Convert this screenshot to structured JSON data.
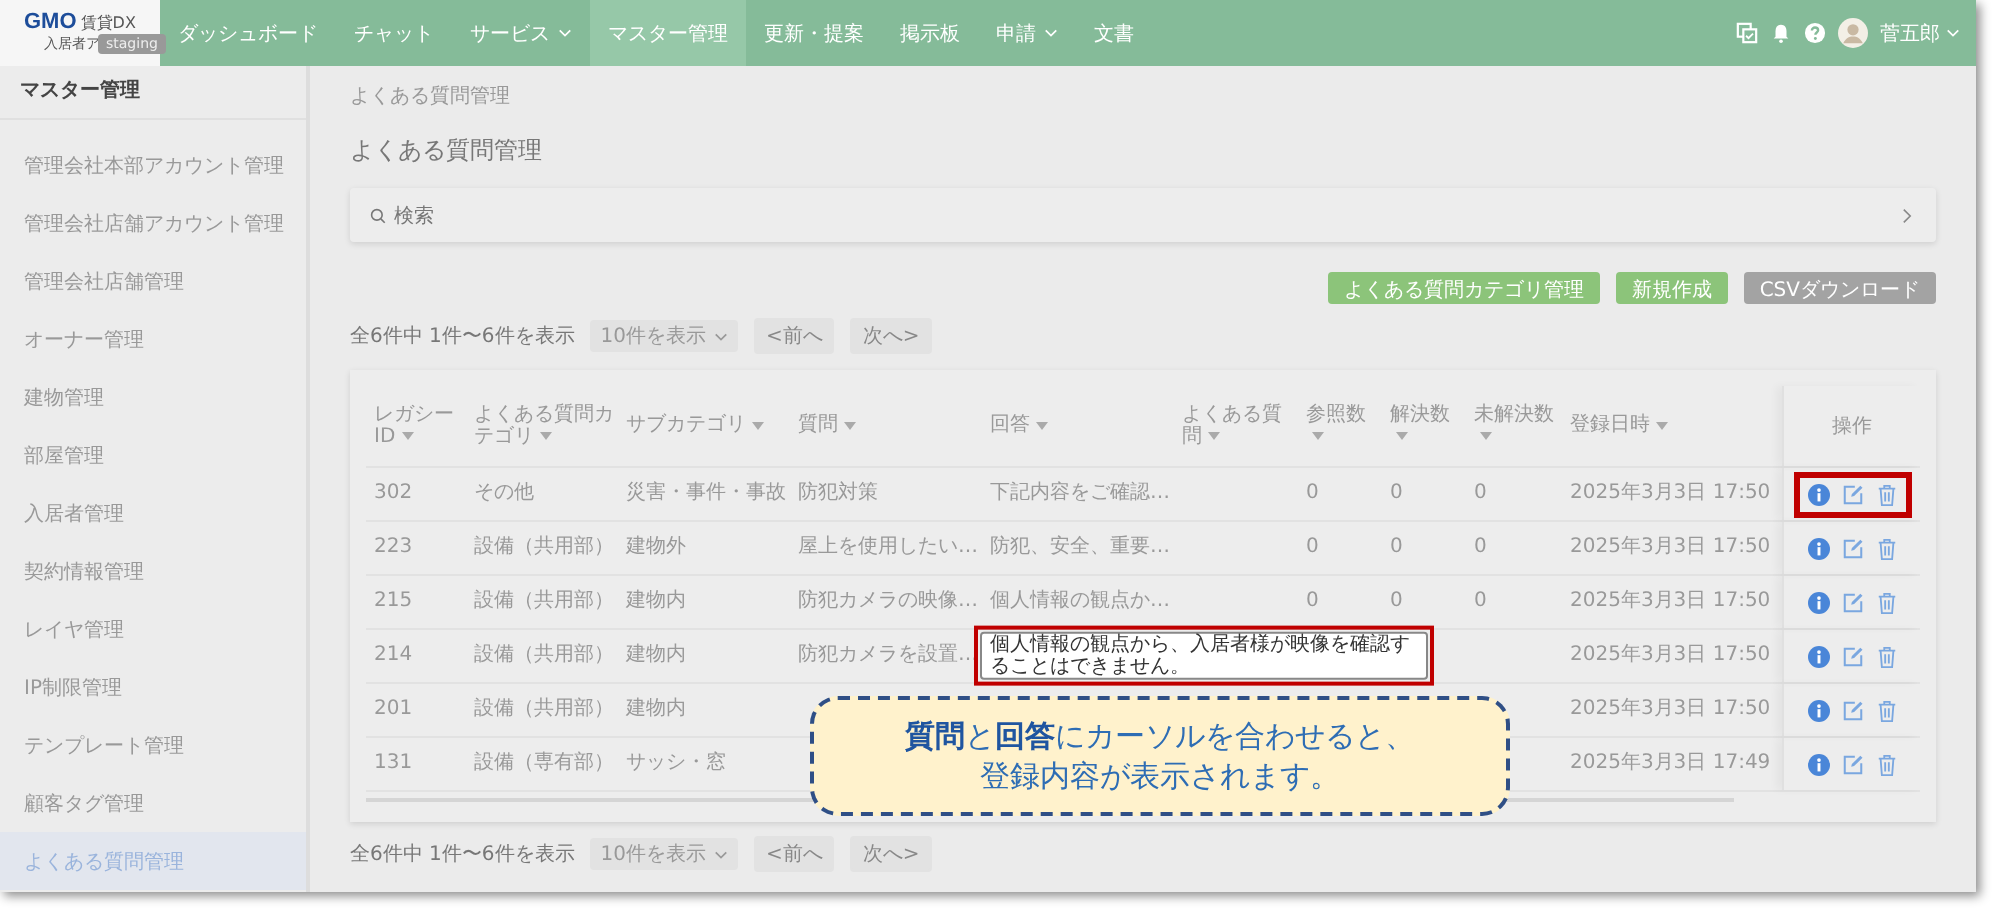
{
  "logo": {
    "brand": "GMO",
    "product": "賃貸DX",
    "subtitle": "入居者ア",
    "badge": "staging"
  },
  "nav": [
    {
      "label": "ダッシュボード",
      "selected": false,
      "dropdown": false
    },
    {
      "label": "チャット",
      "selected": false,
      "dropdown": false
    },
    {
      "label": "サービス",
      "selected": false,
      "dropdown": true
    },
    {
      "label": "マスター管理",
      "selected": true,
      "dropdown": false
    },
    {
      "label": "更新・提案",
      "selected": false,
      "dropdown": false
    },
    {
      "label": "掲示板",
      "selected": false,
      "dropdown": false
    },
    {
      "label": "申請",
      "selected": false,
      "dropdown": true
    },
    {
      "label": "文書",
      "selected": false,
      "dropdown": false
    }
  ],
  "user": {
    "name": "菅五郎"
  },
  "sidebar": {
    "title": "マスター管理",
    "items": [
      {
        "label": "管理会社本部アカウント管理",
        "selected": false
      },
      {
        "label": "管理会社店舗アカウント管理",
        "selected": false
      },
      {
        "label": "管理会社店舗管理",
        "selected": false
      },
      {
        "label": "オーナー管理",
        "selected": false
      },
      {
        "label": "建物管理",
        "selected": false
      },
      {
        "label": "部屋管理",
        "selected": false
      },
      {
        "label": "入居者管理",
        "selected": false
      },
      {
        "label": "契約情報管理",
        "selected": false
      },
      {
        "label": "レイヤ管理",
        "selected": false
      },
      {
        "label": "IP制限管理",
        "selected": false
      },
      {
        "label": "テンプレート管理",
        "selected": false
      },
      {
        "label": "顧客タグ管理",
        "selected": false
      },
      {
        "label": "よくある質問管理",
        "selected": true
      }
    ]
  },
  "breadcrumb": "よくある質問管理",
  "page_title": "よくある質問管理",
  "search": {
    "label": "検索"
  },
  "buttons": [
    {
      "label": "よくある質問カテゴリ管理",
      "kind": "primary"
    },
    {
      "label": "新規作成",
      "kind": "primary"
    },
    {
      "label": "CSVダウンロード",
      "kind": "secondary"
    }
  ],
  "pagination_top": {
    "summary": "全6件中 1件〜6件を表示",
    "page_size": "10件を表示",
    "prev": "<前へ",
    "next": "次へ>",
    "prev_disabled": true,
    "next_disabled": true
  },
  "table": {
    "columns": [
      "レガシーID",
      "よくある質問カテゴリ",
      "サブカテゴリ",
      "質問",
      "回答",
      "よくある質問",
      "参照数",
      "解決数",
      "未解決数",
      "登録日時"
    ],
    "actions_column": "操作",
    "rows": [
      {
        "cells": [
          "302",
          "その他",
          "災害・事件・事故",
          "防犯対策",
          "下記内容をご確認…",
          null,
          "0",
          "0",
          "0",
          "2025年3月3日 17:50"
        ],
        "actions_highlighted": true
      },
      {
        "cells": [
          "223",
          "設備（共用部）",
          "建物外",
          "屋上を使用したい…",
          "防犯、安全、重要…",
          null,
          "0",
          "0",
          "0",
          "2025年3月3日 17:50"
        ],
        "actions_highlighted": false
      },
      {
        "cells": [
          "215",
          "設備（共用部）",
          "建物内",
          "防犯カメラの映像…",
          "個人情報の観点か…",
          null,
          "0",
          "0",
          "0",
          "2025年3月3日 17:50"
        ],
        "actions_highlighted": false
      },
      {
        "cells": [
          "214",
          "設備（共用部）",
          "建物内",
          "防犯カメラを設置…",
          null,
          null,
          null,
          null,
          null,
          "2025年3月3日 17:50"
        ],
        "tooltip": {
          "text": "個人情報の観点から、入居者様が映像を確認することはできません。",
          "highlighted": true
        },
        "actions_highlighted": false
      },
      {
        "cells": [
          "201",
          "設備（共用部）",
          "建物内",
          null,
          null,
          null,
          null,
          null,
          null,
          "2025年3月3日 17:50"
        ],
        "actions_highlighted": false
      },
      {
        "cells": [
          "131",
          "設備（専有部）",
          "サッシ・窓",
          null,
          null,
          null,
          null,
          null,
          null,
          "2025年3月3日 17:49"
        ],
        "actions_highlighted": false
      }
    ]
  },
  "pagination_bottom": {
    "summary": "全6件中 1件〜6件を表示",
    "page_size": "10件を表示",
    "prev": "<前へ",
    "next": "次へ>",
    "prev_disabled": true,
    "next_disabled": true
  },
  "callout": {
    "lines": [
      "**質問**と**回答**にカーソルを合わせると、",
      "登録内容が表示されます。"
    ]
  }
}
